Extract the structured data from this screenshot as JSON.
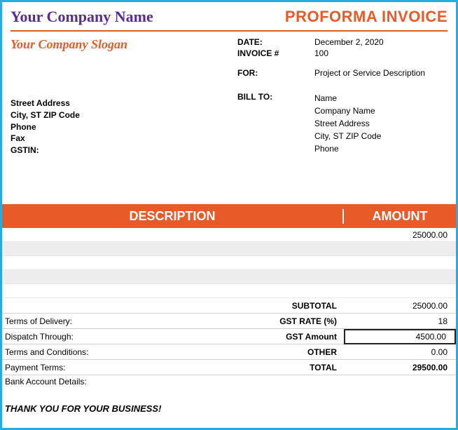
{
  "header": {
    "company_name": "Your Company Name",
    "doc_title": "PROFORMA INVOICE",
    "slogan": "Your Company Slogan"
  },
  "meta": {
    "date_label": "DATE:",
    "date_value": "December 2, 2020",
    "invoice_label": "INVOICE #",
    "invoice_value": "100",
    "for_label": "FOR:",
    "for_value": "Project or Service Description"
  },
  "from": {
    "street": "Street Address",
    "city": "City, ST  ZIP Code",
    "phone": "Phone",
    "fax": "Fax",
    "gstin_label": "GSTIN:"
  },
  "billto": {
    "label": "BILL TO:",
    "name": "Name",
    "company": "Company Name",
    "street": "Street Address",
    "city": "City, ST  ZIP Code",
    "phone": "Phone"
  },
  "table": {
    "head_desc": "DESCRIPTION",
    "head_amt": "AMOUNT",
    "rows": [
      {
        "desc": "",
        "amount": "25000.00"
      },
      {
        "desc": "",
        "amount": ""
      },
      {
        "desc": "",
        "amount": ""
      },
      {
        "desc": "",
        "amount": ""
      },
      {
        "desc": "",
        "amount": ""
      }
    ]
  },
  "summary": {
    "subtotal_label": "SUBTOTAL",
    "subtotal_value": "25000.00",
    "terms_delivery_label": "Terms of Delivery:",
    "gst_rate_label": "GST RATE (%)",
    "gst_rate_value": "18",
    "dispatch_label": "Dispatch Through:",
    "gst_amount_label": "GST Amount",
    "gst_amount_value": "4500.00",
    "terms_cond_label": "Terms and Conditions:",
    "other_label": "OTHER",
    "other_value": "0.00",
    "payment_terms_label": "Payment Terms:",
    "total_label": "TOTAL",
    "total_value": "29500.00",
    "bank_label": "Bank Account Details:"
  },
  "footer": {
    "thanks": "THANK YOU FOR YOUR BUSINESS!"
  }
}
